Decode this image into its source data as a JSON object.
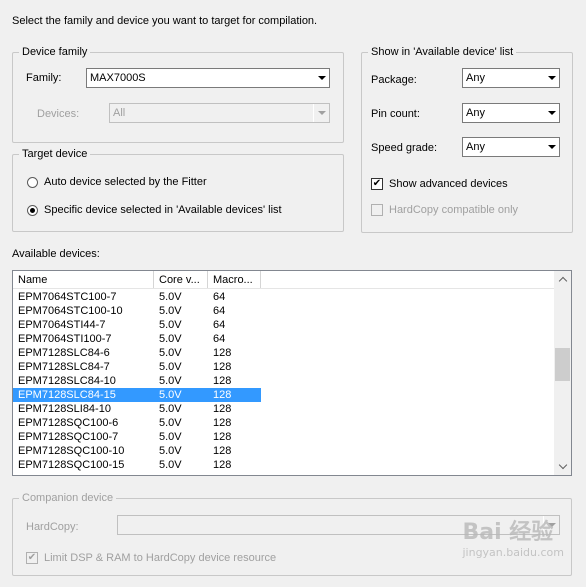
{
  "instruction": "Select the family and device you want to target for compilation.",
  "device_family": {
    "legend": "Device family",
    "family_label": "Family:",
    "family_value": "MAX7000S",
    "devices_label": "Devices:",
    "devices_value": "All"
  },
  "show_in_list": {
    "legend": "Show in 'Available device' list",
    "package_label": "Package:",
    "package_value": "Any",
    "pin_count_label": "Pin count:",
    "pin_count_value": "Any",
    "speed_grade_label": "Speed grade:",
    "speed_grade_value": "Any",
    "show_advanced_label": "Show advanced devices",
    "show_advanced_checked": true,
    "hardcopy_compatible_label": "HardCopy compatible only",
    "hardcopy_compatible_checked": false
  },
  "target_device": {
    "legend": "Target device",
    "auto_label": "Auto device selected by the Fitter",
    "specific_label": "Specific device selected in 'Available devices' list",
    "selected_option": "specific"
  },
  "available_devices": {
    "label": "Available devices:",
    "columns": [
      "Name",
      "Core v...",
      "Macro..."
    ],
    "rows": [
      [
        "EPM7064STC100-7",
        "5.0V",
        "64"
      ],
      [
        "EPM7064STC100-10",
        "5.0V",
        "64"
      ],
      [
        "EPM7064STI44-7",
        "5.0V",
        "64"
      ],
      [
        "EPM7064STI100-7",
        "5.0V",
        "64"
      ],
      [
        "EPM7128SLC84-6",
        "5.0V",
        "128"
      ],
      [
        "EPM7128SLC84-7",
        "5.0V",
        "128"
      ],
      [
        "EPM7128SLC84-10",
        "5.0V",
        "128"
      ],
      [
        "EPM7128SLC84-15",
        "5.0V",
        "128"
      ],
      [
        "EPM7128SLI84-10",
        "5.0V",
        "128"
      ],
      [
        "EPM7128SQC100-6",
        "5.0V",
        "128"
      ],
      [
        "EPM7128SQC100-7",
        "5.0V",
        "128"
      ],
      [
        "EPM7128SQC100-10",
        "5.0V",
        "128"
      ],
      [
        "EPM7128SQC100-15",
        "5.0V",
        "128"
      ]
    ],
    "selected_index": 7
  },
  "companion_device": {
    "legend": "Companion device",
    "hardcopy_label": "HardCopy:",
    "hardcopy_value": "",
    "limit_label": "Limit DSP & RAM to HardCopy device resource",
    "limit_checked": true
  },
  "watermark": {
    "text": "Bai 经验",
    "sub": "jingyan.baidu.com"
  },
  "colors": {
    "selection": "#3399ff",
    "background": "#f0f0f0"
  }
}
